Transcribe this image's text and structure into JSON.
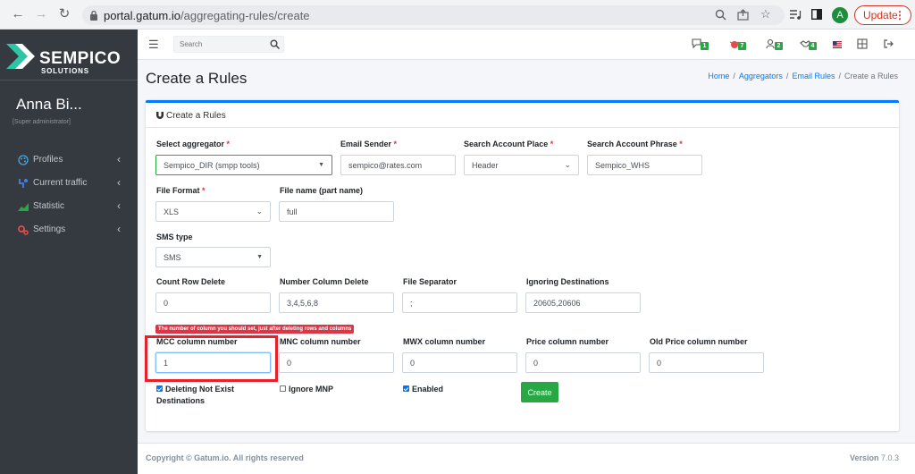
{
  "browser": {
    "url_host": "portal.gatum.io",
    "url_path": "/aggregating-rules/create",
    "profile_initial": "A",
    "update_label": "Update"
  },
  "sidebar": {
    "logo_word": "SEMPICO",
    "logo_sub": "SOLUTIONS",
    "user_name": "Anna Bi...",
    "user_role": "[Super administrator]",
    "items": [
      {
        "label": "Profiles",
        "icon": "palette-icon"
      },
      {
        "label": "Current traffic",
        "icon": "traffic-icon"
      },
      {
        "label": "Statistic",
        "icon": "chart-icon"
      },
      {
        "label": "Settings",
        "icon": "gears-icon"
      }
    ]
  },
  "topnav": {
    "search_placeholder": "Search",
    "badges": [
      {
        "icon": "chat-icon",
        "count": "1",
        "color": "#28a745"
      },
      {
        "icon": "bug-icon",
        "count": "7",
        "color": "#28a745"
      },
      {
        "icon": "users-icon",
        "count": "2",
        "color": "#28a745"
      },
      {
        "icon": "handshake-icon",
        "count": "4",
        "color": "#28a745"
      }
    ]
  },
  "page": {
    "title": "Create a Rules",
    "breadcrumb": [
      "Home",
      "Aggregators",
      "Email Rules",
      "Create a Rules"
    ]
  },
  "card": {
    "title": "Create a Rules"
  },
  "form": {
    "aggregator_label": "Select aggregator",
    "aggregator_value": "Sempico_DIR (smpp tools)",
    "email_sender_label": "Email Sender",
    "email_sender_value": "sempico@rates.com",
    "search_place_label": "Search Account Place",
    "search_place_value": "Header",
    "search_phrase_label": "Search Account Phrase",
    "search_phrase_value": "Sempico_WHS",
    "file_format_label": "File Format",
    "file_format_value": "XLS",
    "file_name_label": "File name (part name)",
    "file_name_value": "full",
    "sms_type_label": "SMS type",
    "sms_type_value": "SMS",
    "count_row_delete_label": "Count Row Delete",
    "count_row_delete_value": "0",
    "number_column_delete_label": "Number Column Delete",
    "number_column_delete_value": "3,4,5,6,8",
    "file_separator_label": "File Separator",
    "file_separator_value": ";",
    "ignoring_destinations_label": "Ignoring Destinations",
    "ignoring_destinations_value": "20605,20606",
    "tip_text": "The number of column you should set, just after deleting rows and columns",
    "mcc_label": "MCC column number",
    "mcc_value": "1",
    "mnc_label": "MNC column number",
    "mnc_value": "0",
    "mwx_label": "MWX column number",
    "mwx_value": "0",
    "price_label": "Price column number",
    "price_value": "0",
    "old_price_label": "Old Price column number",
    "old_price_value": "0",
    "deleting_label": "Deleting Not Exist Destinations",
    "deleting_checked": true,
    "ignore_mnp_label": "Ignore MNP",
    "ignore_mnp_checked": false,
    "enabled_label": "Enabled",
    "enabled_checked": true,
    "create_label": "Create",
    "required_mark": "*"
  },
  "footer": {
    "copyright": "Copyright © Gatum.io. All rights reserved",
    "version_label": "Version",
    "version_value": "7.0.3"
  }
}
